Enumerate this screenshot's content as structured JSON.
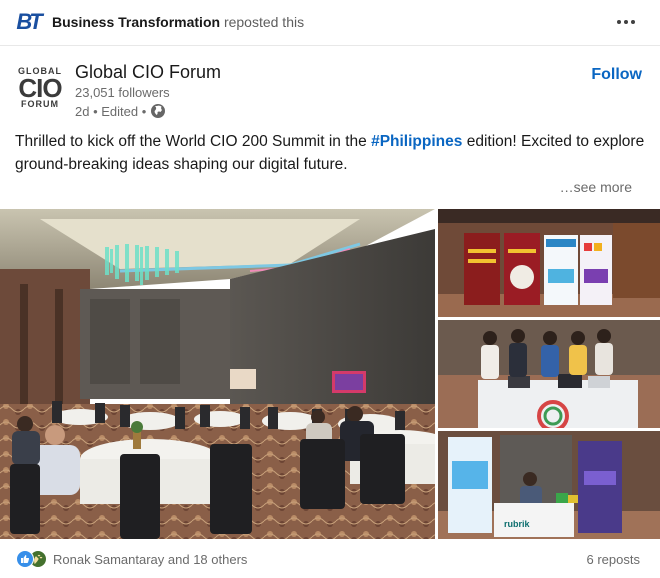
{
  "repost": {
    "logo_text": "BT",
    "actor": "Business Transformation",
    "action": "reposted this"
  },
  "author": {
    "logo_small_top": "GLOBAL",
    "logo_big": "CIO",
    "logo_small_bottom": "FORUM",
    "name": "Global CIO Forum",
    "followers": "23,051 followers",
    "meta": "2d • Edited •",
    "follow_label": "Follow"
  },
  "post": {
    "text_before": "Thrilled to kick off the World CIO 200 Summit in the ",
    "hashtag": "#Philippines",
    "text_after": " edition! Excited to explore ground-breaking ideas shaping our digital future.",
    "see_more": "…see more"
  },
  "images": {
    "booth_banner_text": "rubrik"
  },
  "footer": {
    "reactions_text": "Ronak Samantaray and 18 others",
    "reposts": "6 reposts"
  },
  "colors": {
    "accent": "#0a66c2",
    "bt_logo": "#1a4fa0",
    "like": "#378fe9",
    "celebrate": "#44712e"
  },
  "icons": [
    "more-icon",
    "globe-icon",
    "like-icon",
    "celebrate-icon"
  ]
}
